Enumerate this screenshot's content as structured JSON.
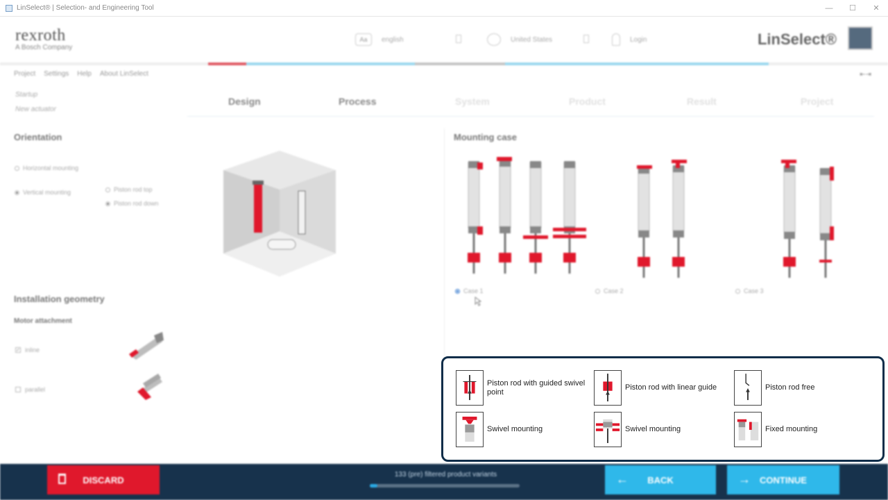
{
  "window": {
    "title": "LinSelect® | Selection- and Engineering Tool",
    "controls": [
      "—",
      "☐",
      "✕"
    ]
  },
  "header": {
    "brand": "rexroth",
    "tagline": "A Bosch Company",
    "language": "english",
    "language_icon": "Aa",
    "country": "United States",
    "login": "Login",
    "product": "LinSelect®"
  },
  "menu": {
    "items": [
      "Project",
      "Settings",
      "Help",
      "About LinSelect"
    ],
    "collapse": "⇤⇥"
  },
  "breadcrumbs": [
    "Startup",
    "New actuator"
  ],
  "steps": [
    {
      "label": "Design",
      "state": "active"
    },
    {
      "label": "Process",
      "state": "active"
    },
    {
      "label": "System",
      "state": "inactive"
    },
    {
      "label": "Product",
      "state": "inactive"
    },
    {
      "label": "Result",
      "state": "inactive"
    },
    {
      "label": "Project",
      "state": "inactive"
    }
  ],
  "orientation": {
    "title": "Orientation",
    "horizontal": "Horizontal mounting",
    "vertical": "Vertical mounting",
    "piston_top": "Piston rod top",
    "piston_down": "Piston rod down",
    "selected": "vertical",
    "selected_sub": "piston_down"
  },
  "installation": {
    "title": "Installation geometry",
    "motor_title": "Motor attachment",
    "inline": "inline",
    "parallel": "parallel",
    "inline_checked": true,
    "parallel_checked": false
  },
  "mounting": {
    "title": "Mounting case",
    "cases": [
      "Case 1",
      "Case 2",
      "Case 3"
    ],
    "selected_case": "Case 1"
  },
  "legend": [
    {
      "icon": "guided-swivel-point-icon",
      "label": "Piston rod with guided swivel point"
    },
    {
      "icon": "linear-guide-icon",
      "label": "Piston rod with linear guide"
    },
    {
      "icon": "piston-free-icon",
      "label": "Piston rod free"
    },
    {
      "icon": "swivel-mounting-top-icon",
      "label": "Swivel mounting"
    },
    {
      "icon": "swivel-mounting-mid-icon",
      "label": "Swivel mounting"
    },
    {
      "icon": "fixed-mounting-icon",
      "label": "Fixed mounting"
    }
  ],
  "footer": {
    "discard": "DISCARD",
    "variants": "133 (pre) filtered product variants",
    "variants_progress": 0.05,
    "back": "BACK",
    "continue": "CONTINUE"
  },
  "colors": {
    "accent_red": "#e0182c",
    "accent_blue": "#2fb8ea",
    "footer_bg": "#17324c",
    "callout_border": "#0f2d49"
  }
}
